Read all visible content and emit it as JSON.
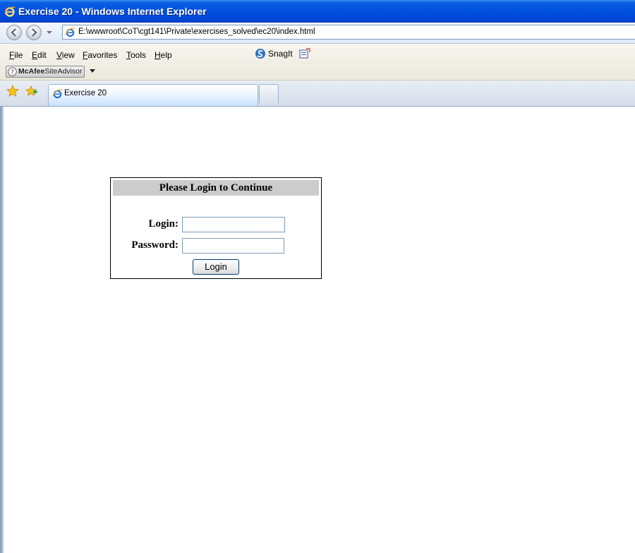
{
  "window": {
    "title": "Exercise 20 - Windows Internet Explorer"
  },
  "navigation": {
    "url": "E:\\wwwroot\\CoT\\cgt141\\Private\\exercises_solved\\ec20\\index.html"
  },
  "menu": {
    "items": [
      {
        "accel": "F",
        "rest": "ile"
      },
      {
        "accel": "E",
        "rest": "dit"
      },
      {
        "accel": "V",
        "rest": "iew"
      },
      {
        "accel": "F",
        "rest": "avorites",
        "first_plain": ""
      },
      {
        "accel": "T",
        "rest": "ools"
      },
      {
        "accel": "H",
        "rest": "elp"
      }
    ],
    "snagit_label": "SnagIt"
  },
  "toolbar": {
    "mcafee_brand": "McAfee",
    "mcafee_product": "SiteAdvisor"
  },
  "tabs": [
    {
      "label": "Exercise 20",
      "active": true
    }
  ],
  "login_form": {
    "header": "Please Login to Continue",
    "login_label": "Login:",
    "password_label": "Password:",
    "login_value": "",
    "password_value": "",
    "submit_label": "Login"
  },
  "colors": {
    "titlebar_blue": "#0050e0",
    "form_header_bg": "#cccccc"
  }
}
